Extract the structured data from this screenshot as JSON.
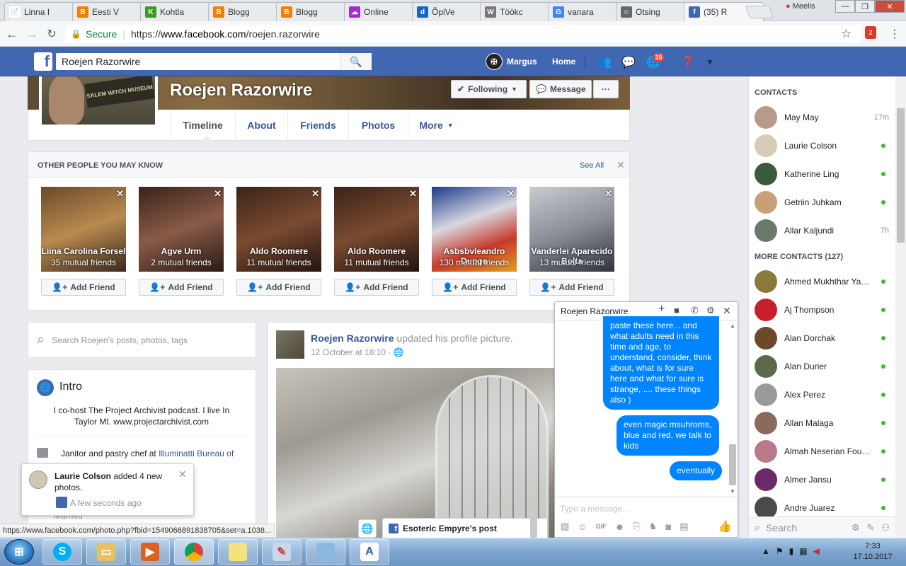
{
  "browser": {
    "tabs": [
      {
        "title": "Linna I",
        "color": "#ffffff",
        "glyph": "📄"
      },
      {
        "title": "Eesti V",
        "color": "#f57d00",
        "glyph": "B"
      },
      {
        "title": "Kohtla",
        "color": "#3c9a2a",
        "glyph": "K"
      },
      {
        "title": "Blogg",
        "color": "#f57d00",
        "glyph": "B"
      },
      {
        "title": "Blogg",
        "color": "#f57d00",
        "glyph": "B"
      },
      {
        "title": "Online",
        "color": "#a52ac9",
        "glyph": "☁"
      },
      {
        "title": "ÕpiVe",
        "color": "#1466c3",
        "glyph": "d"
      },
      {
        "title": "Töökc",
        "color": "#777777",
        "glyph": "W"
      },
      {
        "title": "vanara",
        "color": "#4285f4",
        "glyph": "G"
      },
      {
        "title": "Otsing",
        "color": "#666666",
        "glyph": "☺"
      },
      {
        "title": "(35) R",
        "color": "#4267b2",
        "glyph": "f"
      }
    ],
    "user": "Meelis",
    "secure_label": "Secure",
    "url_prefix": "https://",
    "url_host": "www.facebook.com",
    "url_path": "/roejen.razorwire",
    "status_url": "https://www.facebook.com/photo.php?fbid=1549066891838705&set=a.1038..."
  },
  "fb": {
    "search_value": "Roejen Razorwire",
    "user_name": "Margus",
    "home_label": "Home",
    "notif_count": "35"
  },
  "profile": {
    "name": "Roejen Razorwire",
    "pic_sign": "SALEM WITCH MUSEUM",
    "following_label": "Following",
    "message_label": "Message",
    "more_dots": "···",
    "tabs": [
      "Timeline",
      "About",
      "Friends",
      "Photos",
      "More"
    ]
  },
  "pymk": {
    "title": "OTHER PEOPLE YOU MAY KNOW",
    "see_all": "See All",
    "add_label": "Add Friend",
    "people": [
      {
        "name": "Liina Carolina Forsel",
        "mutual": "35 mutual friends",
        "bg": "linear-gradient(160deg,#6b4a2a,#b88a50 50%,#3a2a1c)"
      },
      {
        "name": "Agve Urm",
        "mutual": "2 mutual friends",
        "bg": "linear-gradient(160deg,#3a2418,#8a5a48 50%,#2a1a14)"
      },
      {
        "name": "Aldo Roomere",
        "mutual": "11 mutual friends",
        "bg": "linear-gradient(160deg,#3b2418,#7a4a30 50%,#241410)"
      },
      {
        "name": "Aldo Roomere",
        "mutual": "11 mutual friends",
        "bg": "linear-gradient(160deg,#3b2418,#7a4a30 50%,#241410)"
      },
      {
        "name": "Asbsbvleandro Dungo",
        "mutual": "130 mutual friends",
        "bg": "linear-gradient(160deg,#1b3a8c,#d8d8e0 40%,#c63a2a 70%,#e0a020)"
      },
      {
        "name": "Vanderlei Aparecido Bolta",
        "mutual": "13 mutual friends",
        "bg": "linear-gradient(160deg,#c9ccd2,#8a8e96 50%,#30343c)"
      }
    ]
  },
  "left": {
    "search_placeholder": "Search Roejen's posts, photos, tags",
    "intro_title": "Intro",
    "bio": "I co-host The Project Archivist podcast. I live In Taylor MI. www.projectarchivist.com",
    "job_prefix": "Janitor and pastry chef at",
    "job_place": "Illuminatti Bureau of",
    "married": "Married"
  },
  "post": {
    "author": "Roejen Razorwire",
    "action": "updated his profile picture.",
    "time": "12 October at 18:10"
  },
  "chat": {
    "title": "Roejen Razorwire",
    "messages": [
      "paste these here... and what adults need in this time and age, to understand, consider, think about, what is for sure here and what for sure is strange, .... these things also )",
      "even magic msuhroms, blue and red, we talk to kids",
      "eventually"
    ],
    "input_placeholder": "Type a message..."
  },
  "esoteric": {
    "label": "Esoteric Empyre's post"
  },
  "notification": {
    "name": "Laurie Colson",
    "text": "added 4 new photos.",
    "time": "A few seconds ago"
  },
  "contacts": {
    "title": "CONTACTS",
    "more_title": "MORE CONTACTS (127)",
    "search_placeholder": "Search",
    "list": [
      {
        "name": "May May",
        "status": "17m",
        "online": false,
        "color": "#b89a88"
      },
      {
        "name": "Laurie Colson",
        "status": "",
        "online": true,
        "color": "#d4ccb4"
      },
      {
        "name": "Katherine Ling",
        "status": "",
        "online": true,
        "color": "#3a5a3a"
      },
      {
        "name": "Getriin Juhkam",
        "status": "",
        "online": true,
        "color": "#c8a078"
      },
      {
        "name": "Allar Kaljundi",
        "status": "7h",
        "online": false,
        "color": "#6a7a6a"
      }
    ],
    "more": [
      {
        "name": "Ahmed Mukhthar Yac...",
        "online": true,
        "color": "#8a7a3a"
      },
      {
        "name": "Aj Thompson",
        "online": true,
        "color": "#c8202a"
      },
      {
        "name": "Alan Dorchak",
        "online": true,
        "color": "#6a4a2a"
      },
      {
        "name": "Alan Durier",
        "online": true,
        "color": "#5a6a4a"
      },
      {
        "name": "Alex Perez",
        "online": true,
        "color": "#9a9a9a"
      },
      {
        "name": "Allan Malaga",
        "online": true,
        "color": "#8a6a5a"
      },
      {
        "name": "Almah Neserian Fouch",
        "online": true,
        "color": "#b87a8a"
      },
      {
        "name": "Almer Jansu",
        "online": true,
        "color": "#6a2a6a"
      },
      {
        "name": "Andre Juarez",
        "online": true,
        "color": "#4a4a4a"
      }
    ]
  },
  "taskbar": {
    "time": "7:33",
    "date": "17.10.2017"
  }
}
